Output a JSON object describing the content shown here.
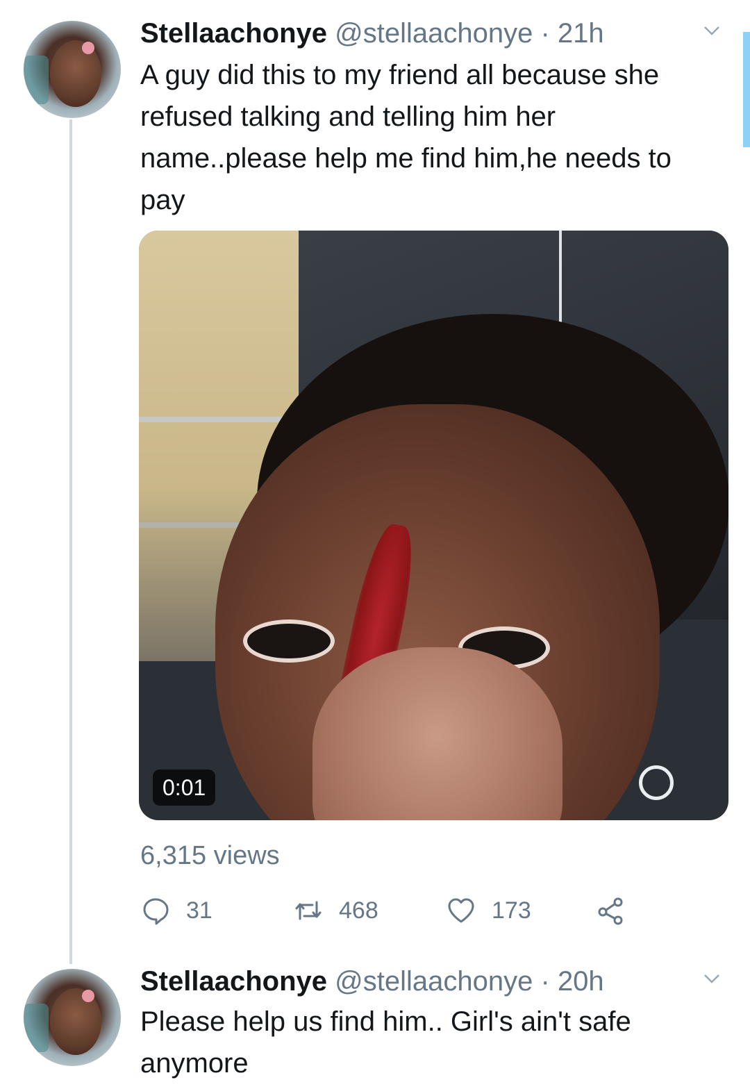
{
  "tweets": [
    {
      "display_name": "Stellaachonye",
      "handle": "@stellaachonye",
      "separator": "·",
      "time": "21h",
      "text": "A guy did this to my friend all because she refused talking and telling him her name..please help me find him,he needs to pay",
      "media": {
        "duration": "0:01"
      },
      "views": "6,315 views",
      "actions": {
        "replies": "31",
        "retweets": "468",
        "likes": "173"
      }
    },
    {
      "display_name": "Stellaachonye",
      "handle": "@stellaachonye",
      "separator": "·",
      "time": "20h",
      "text": "Please help us find him.. Girl's ain't safe anymore"
    }
  ],
  "icons": {
    "more": "chevron-down-icon",
    "reply": "reply-icon",
    "retweet": "retweet-icon",
    "like": "heart-icon",
    "share": "share-icon"
  },
  "colors": {
    "text": "#14171a",
    "secondary": "#657786",
    "thread_line": "#cfd9de"
  }
}
